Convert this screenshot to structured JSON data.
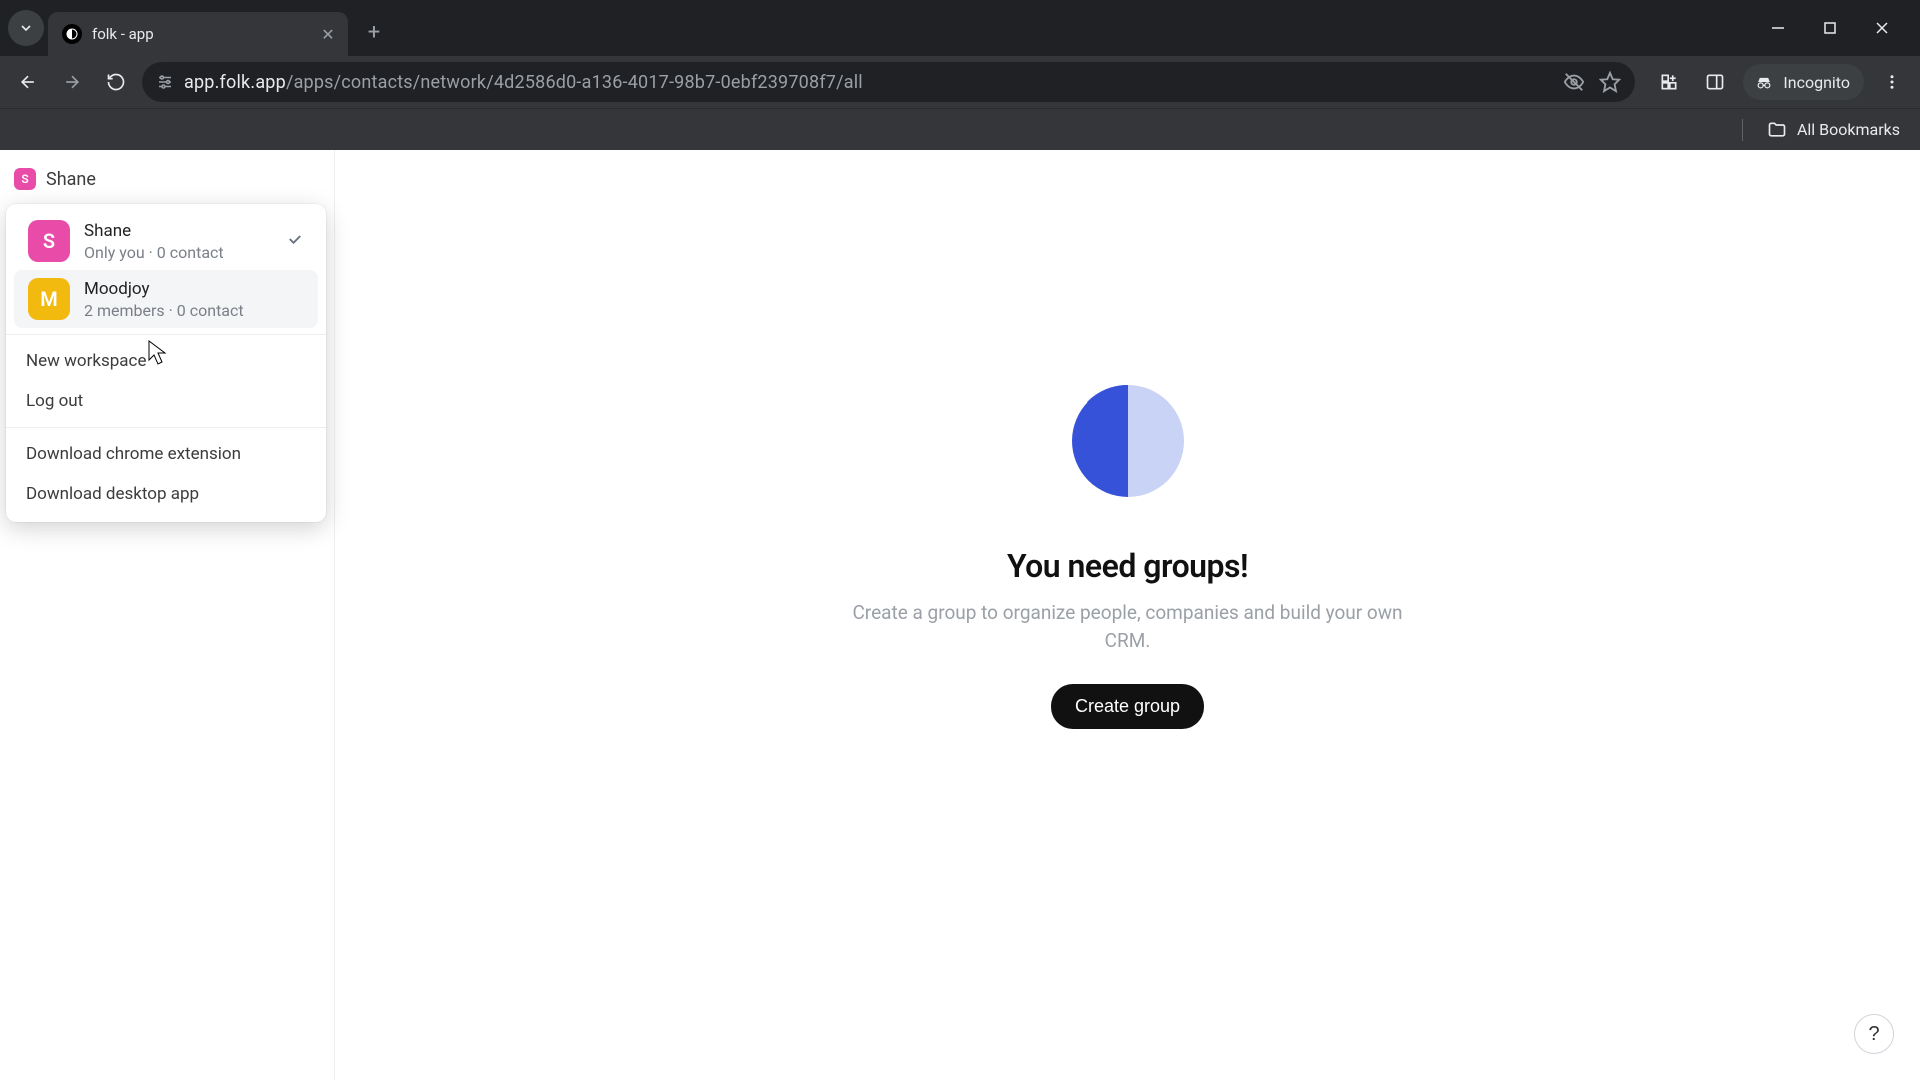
{
  "browser": {
    "tab_title": "folk - app",
    "url_host": "app.folk.app",
    "url_path": "/apps/contacts/network/4d2586d0-a136-4017-98b7-0ebf239708f7/all",
    "incognito_label": "Incognito",
    "all_bookmarks_label": "All Bookmarks"
  },
  "sidebar": {
    "current_workspace": "Shane",
    "current_initial": "S"
  },
  "ws_menu": {
    "items": [
      {
        "name": "Shane",
        "sub": "Only you · 0 contact",
        "initial": "S",
        "color": "#e94ba8",
        "selected": true,
        "hover": false
      },
      {
        "name": "Moodjoy",
        "sub": "2 members · 0 contact",
        "initial": "M",
        "color": "#f2b90f",
        "selected": false,
        "hover": true
      }
    ],
    "new_workspace_label": "New workspace",
    "logout_label": "Log out",
    "download_ext_label": "Download chrome extension",
    "download_app_label": "Download desktop app"
  },
  "empty_state": {
    "title": "You need groups!",
    "subtitle": "Create a group to organize people, companies and build your own CRM.",
    "cta": "Create group"
  },
  "help_label": "?"
}
